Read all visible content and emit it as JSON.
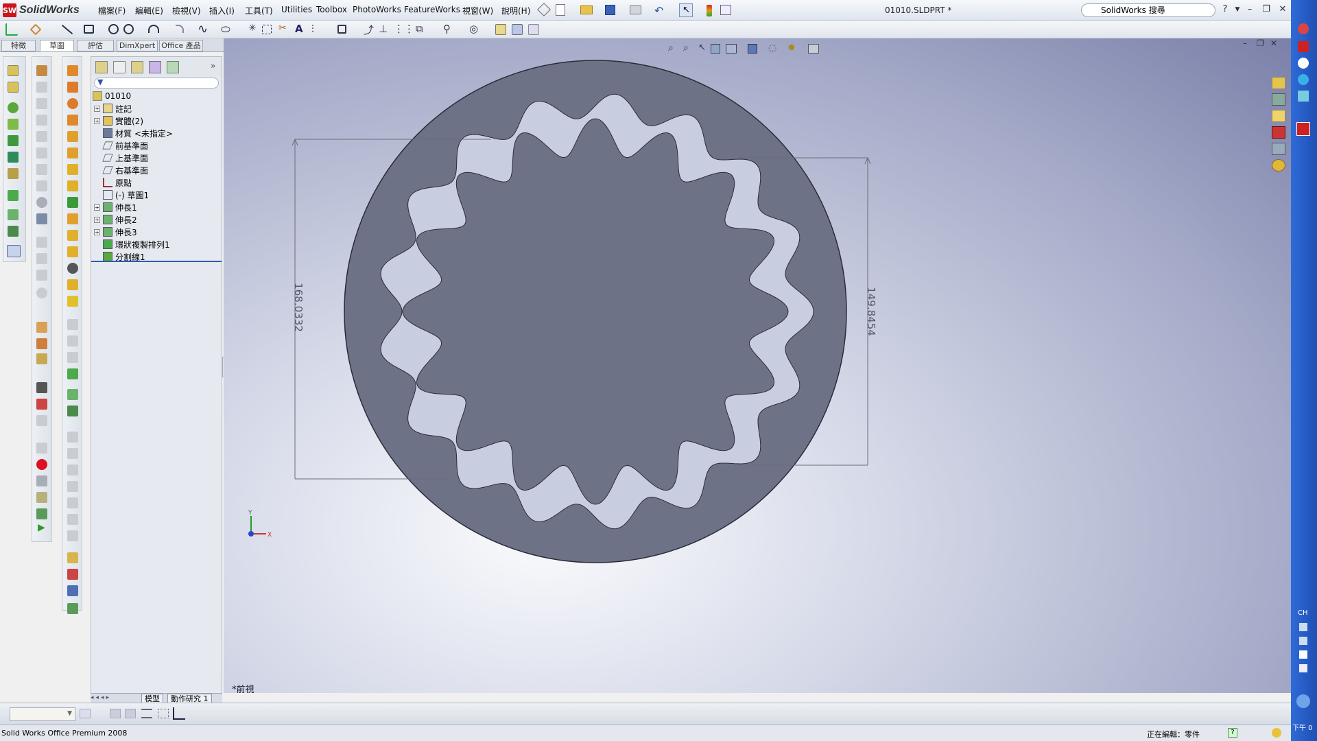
{
  "app": {
    "name": "SolidWorks",
    "doc_title": "01010.SLDPRT *"
  },
  "menu": [
    "檔案(F)",
    "編輯(E)",
    "檢視(V)",
    "插入(I)",
    "工具(T)",
    "Utilities",
    "Toolbox",
    "PhotoWorks",
    "FeatureWorks",
    "視窗(W)",
    "說明(H)"
  ],
  "search": {
    "value": "SolidWorks 搜尋"
  },
  "command_tabs": [
    "特徵",
    "草圖",
    "評估",
    "DimXpert",
    "Office 產品"
  ],
  "feature_tree": {
    "root": "01010",
    "items": [
      {
        "label": "註記",
        "expandable": true,
        "icon": "annotation-icon"
      },
      {
        "label": "實體(2)",
        "expandable": true,
        "icon": "solid-bodies-icon"
      },
      {
        "label": "材質 <未指定>",
        "expandable": false,
        "icon": "material-icon"
      },
      {
        "label": "前基準面",
        "expandable": false,
        "icon": "plane-icon"
      },
      {
        "label": "上基準面",
        "expandable": false,
        "icon": "plane-icon"
      },
      {
        "label": "右基準面",
        "expandable": false,
        "icon": "plane-icon"
      },
      {
        "label": "原點",
        "expandable": false,
        "icon": "origin-icon"
      },
      {
        "label": "(-) 草圖1",
        "expandable": false,
        "icon": "sketch-icon"
      },
      {
        "label": "伸長1",
        "expandable": true,
        "icon": "extrude-icon"
      },
      {
        "label": "伸長2",
        "expandable": true,
        "icon": "extrude-icon"
      },
      {
        "label": "伸長3",
        "expandable": true,
        "icon": "extrude-icon"
      },
      {
        "label": "環狀複製排列1",
        "expandable": false,
        "icon": "circular-pattern-icon"
      },
      {
        "label": "分割線1",
        "expandable": false,
        "icon": "split-line-icon"
      }
    ]
  },
  "bottom_tabs": [
    "模型",
    "動作研究 1"
  ],
  "viewport": {
    "view_name": "*前視",
    "dimension_left": "168.0332",
    "dimension_right": "149.8454",
    "axis_x_label": "X",
    "axis_y_label": "Y",
    "part_color": "#6e7287"
  },
  "status": {
    "left": "Solid Works Office Premium 2008",
    "editing": "正在編輯：零件"
  },
  "taskbar": {
    "ime": "CH",
    "clock": "下午 0"
  }
}
